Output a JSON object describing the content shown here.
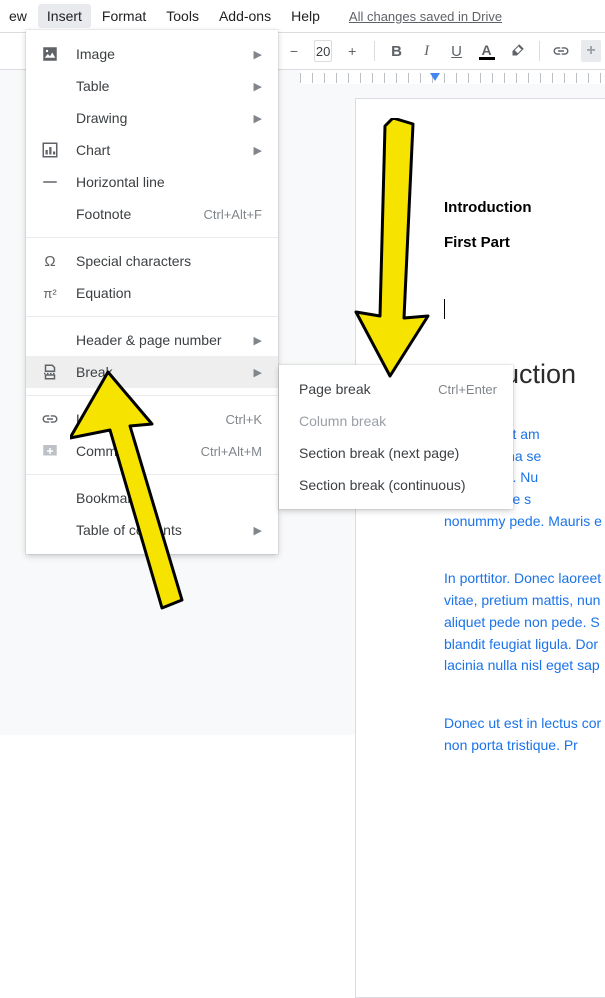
{
  "menubar": {
    "items": [
      {
        "label": "ew",
        "id": "view"
      },
      {
        "label": "Insert",
        "id": "insert",
        "active": true
      },
      {
        "label": "Format",
        "id": "format"
      },
      {
        "label": "Tools",
        "id": "tools"
      },
      {
        "label": "Add-ons",
        "id": "addons"
      },
      {
        "label": "Help",
        "id": "help"
      }
    ],
    "status": "All changes saved in Drive"
  },
  "toolbar": {
    "minus": "−",
    "font_size": "20",
    "plus": "+",
    "bold": "B",
    "italic": "I",
    "underline": "U",
    "textcolor_glyph": "A"
  },
  "insert_menu": {
    "image": "Image",
    "table": "Table",
    "drawing": "Drawing",
    "chart": "Chart",
    "horizontal_line": "Horizontal line",
    "footnote": "Footnote",
    "footnote_shortcut": "Ctrl+Alt+F",
    "special_chars": "Special characters",
    "equation": "Equation",
    "header_page_number": "Header & page number",
    "break": "Break",
    "link": "Link",
    "link_shortcut": "Ctrl+K",
    "comment": "Comment",
    "comment_shortcut": "Ctrl+Alt+M",
    "bookmark": "Bookmark",
    "table_of_contents": "Table of contents"
  },
  "break_submenu": {
    "page_break": "Page break",
    "page_break_shortcut": "Ctrl+Enter",
    "column_break": "Column break",
    "section_next": "Section break (next page)",
    "section_cont": "Section break (continuous)"
  },
  "document": {
    "h1": "Introduction",
    "h2": "First Part",
    "title_big": "uction",
    "para1": "um dolor sit am\nuere, magna se\ns quis urna. Nu\norbi tristique s\nnonummy pede. Mauris e",
    "para2": "In porttitor. Donec laoreet\nvitae, pretium mattis, nun\naliquet pede non pede. S\nblandit feugiat ligula. Dor\nlacinia nulla nisl eget sap",
    "para3": "Donec ut est in lectus cor\nnon porta tristique. Pr"
  }
}
